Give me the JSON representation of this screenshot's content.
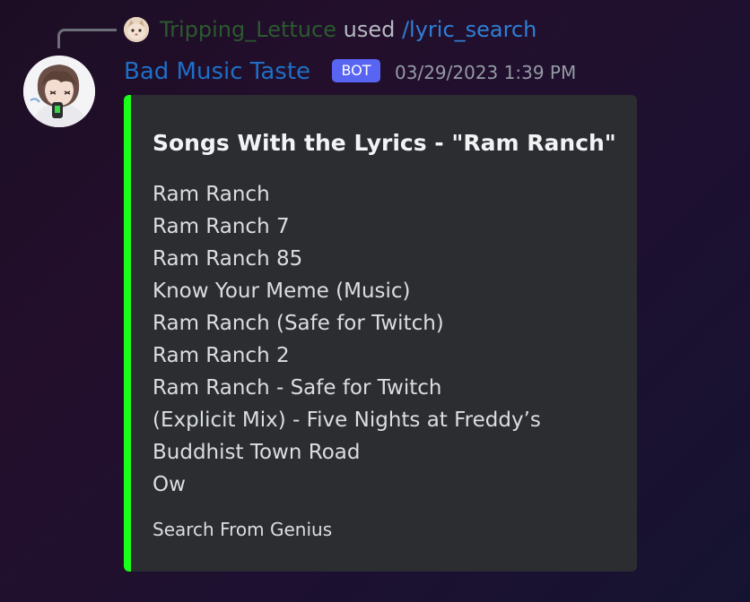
{
  "reply": {
    "username": "Tripping_Lettuce",
    "used_text": "used",
    "command": "/lyric_search"
  },
  "message": {
    "bot_name": "Bad Music Taste",
    "bot_tag": "BOT",
    "timestamp": "03/29/2023 1:39 PM"
  },
  "embed": {
    "accent_color": "#19ff19",
    "title": "Songs With the Lyrics - \"Ram Ranch\"",
    "songs": [
      "Ram Ranch",
      "Ram Ranch 7",
      "Ram Ranch 85",
      "Know Your Meme (Music)",
      "Ram Ranch (Safe for Twitch)",
      "Ram Ranch 2",
      "Ram Ranch - Safe for Twitch",
      "(Explicit Mix) - Five Nights at Freddy’s",
      "Buddhist Town Road",
      "Ow"
    ],
    "footer": "Search From Genius"
  },
  "colors": {
    "bot_name": "#1f6fc6",
    "bot_tag_bg": "#5865f2",
    "reply_username": "#2b5a2f",
    "reply_command": "#2f7fd6",
    "embed_bg": "#2b2d31"
  }
}
